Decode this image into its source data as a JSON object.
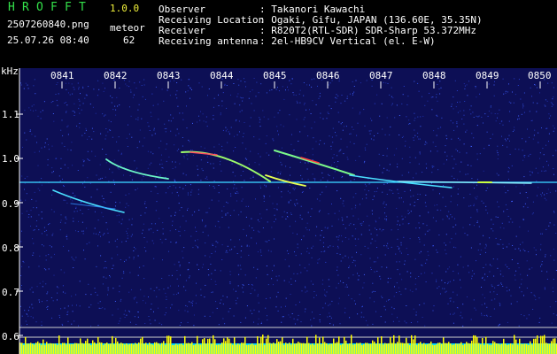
{
  "app": {
    "title_letters": [
      "H",
      "R",
      "O",
      "F",
      "F",
      "T"
    ],
    "version": "1.0.0"
  },
  "file": {
    "filename": "2507260840.png",
    "datetime": "25.07.26 08:40",
    "meteor_label": "meteor",
    "meteor_count": "62"
  },
  "info": {
    "rows": [
      {
        "key": "Observer",
        "value": ": Takanori Kawachi"
      },
      {
        "key": "Receiving Location",
        "value": ": Ogaki, Gifu, JAPAN (136.60E, 35.35N)"
      },
      {
        "key": "Receiver",
        "value": ": R820T2(RTL-SDR) SDR-Sharp 53.372MHz"
      },
      {
        "key": "Receiving antenna",
        "value": ": 2el-HB9CV Vertical (el. E-W)"
      }
    ]
  },
  "axis": {
    "unit": "kHz",
    "y_ticks": [
      "1.1",
      "1.0",
      "0.9",
      "0.8",
      "0.7",
      "0.6"
    ],
    "x_ticks": [
      "0841",
      "0842",
      "0843",
      "0844",
      "0845",
      "0846",
      "0847",
      "0848",
      "0849",
      "0850"
    ]
  },
  "colors": {
    "background": "#101060",
    "noise": "#2a3fcf",
    "header_green": "#33e04a",
    "header_yellow": "#f2f23a",
    "baseline_cyan": "#00d8ff",
    "peak_yellow": "#ffff00"
  }
}
